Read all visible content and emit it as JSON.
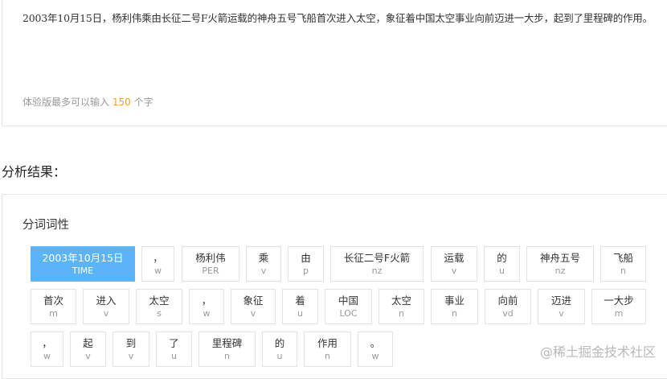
{
  "input": {
    "text": "2003年10月15日，杨利伟乘由长征二号F火箭运载的神舟五号飞船首次进入太空，象征着中国太空事业向前迈进一大步，起到了里程碑的作用。",
    "limit_prefix": "体验版最多可以输入",
    "limit_number": "150",
    "limit_suffix": "个字"
  },
  "section_title": "分析结果：",
  "result": {
    "title": "分词词性",
    "tokens": [
      {
        "word": "2003年10月15日",
        "tag": "TIME",
        "active": true
      },
      {
        "word": "，",
        "tag": "w"
      },
      {
        "word": "杨利伟",
        "tag": "PER"
      },
      {
        "word": "乘",
        "tag": "v"
      },
      {
        "word": "由",
        "tag": "p"
      },
      {
        "word": "长征二号F火箭",
        "tag": "nz"
      },
      {
        "word": "运载",
        "tag": "v"
      },
      {
        "word": "的",
        "tag": "u"
      },
      {
        "word": "神舟五号",
        "tag": "nz"
      },
      {
        "word": "飞船",
        "tag": "n"
      },
      {
        "word": "首次",
        "tag": "m"
      },
      {
        "word": "进入",
        "tag": "v"
      },
      {
        "word": "太空",
        "tag": "s"
      },
      {
        "word": "，",
        "tag": "w"
      },
      {
        "word": "象征",
        "tag": "v"
      },
      {
        "word": "着",
        "tag": "u"
      },
      {
        "word": "中国",
        "tag": "LOC"
      },
      {
        "word": "太空",
        "tag": "n"
      },
      {
        "word": "事业",
        "tag": "n"
      },
      {
        "word": "向前",
        "tag": "vd"
      },
      {
        "word": "迈进",
        "tag": "v"
      },
      {
        "word": "一大步",
        "tag": "m"
      },
      {
        "word": "，",
        "tag": "w"
      },
      {
        "word": "起",
        "tag": "v"
      },
      {
        "word": "到",
        "tag": "v"
      },
      {
        "word": "了",
        "tag": "u"
      },
      {
        "word": "里程碑",
        "tag": "n"
      },
      {
        "word": "的",
        "tag": "u"
      },
      {
        "word": "作用",
        "tag": "n"
      },
      {
        "word": "。",
        "tag": "w"
      }
    ]
  },
  "watermark": "@稀土掘金技术社区",
  "colors": {
    "active_token": "#5ab4f7",
    "limit_number": "#f0a023"
  }
}
